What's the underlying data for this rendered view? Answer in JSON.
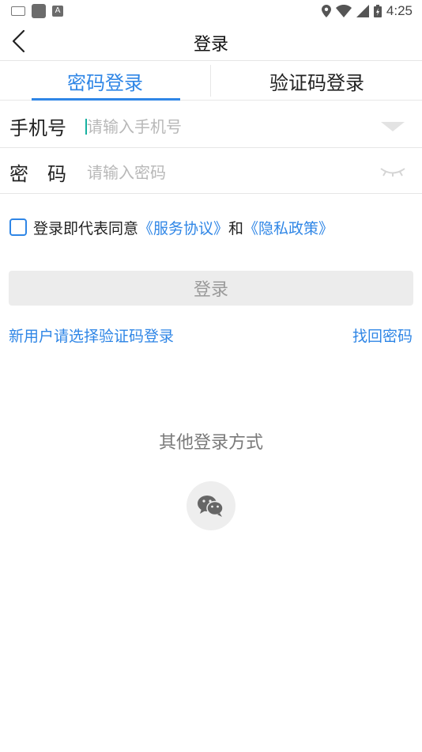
{
  "status_bar": {
    "time": "4:25",
    "left_icons": [
      "keyboard-icon",
      "notification-square-icon",
      "a-badge-icon"
    ],
    "right_icons": [
      "location-icon",
      "wifi-icon",
      "signal-icon",
      "battery-icon"
    ]
  },
  "nav": {
    "title": "登录",
    "back_icon": "chevron-left-icon"
  },
  "tabs": {
    "password_login": "密码登录",
    "code_login": "验证码登录",
    "active": "password_login",
    "active_color": "#2f86e6"
  },
  "form": {
    "phone_label": "手机号",
    "phone_placeholder": "请输入手机号",
    "phone_value": "",
    "password_label": "密　码",
    "password_placeholder": "请输入密码",
    "password_value": ""
  },
  "agreement": {
    "checked": false,
    "prefix": "登录即代表同意",
    "service_link": "《服务协议》",
    "and": "和",
    "privacy_link": "《隐私政策》"
  },
  "login_button": "登录",
  "links": {
    "new_user": "新用户请选择验证码登录",
    "forgot_password": "找回密码"
  },
  "other_login": {
    "title": "其他登录方式",
    "providers": [
      "wechat-icon"
    ]
  }
}
